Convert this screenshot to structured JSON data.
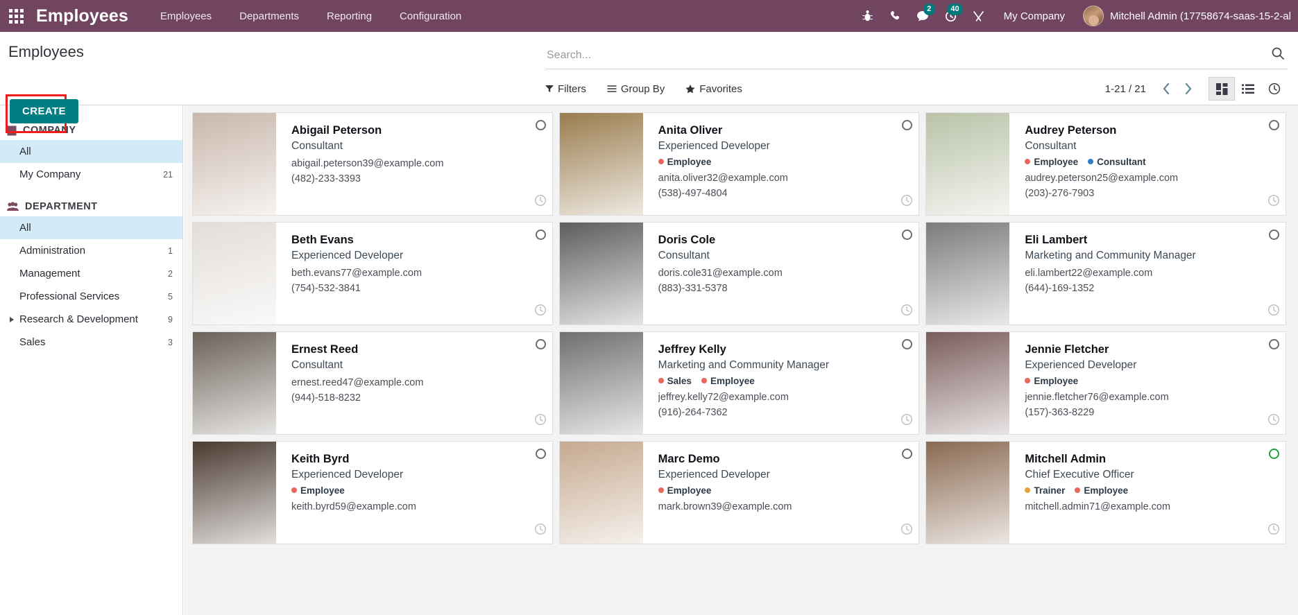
{
  "navbar": {
    "apps_icon": "apps-grid-icon",
    "brand": "Employees",
    "menu": [
      {
        "label": "Employees"
      },
      {
        "label": "Departments"
      },
      {
        "label": "Reporting"
      },
      {
        "label": "Configuration"
      }
    ],
    "icons": [
      {
        "name": "bug-icon",
        "badge": ""
      },
      {
        "name": "phone-icon",
        "badge": ""
      },
      {
        "name": "messages-icon",
        "badge": "2"
      },
      {
        "name": "activities-clock-icon",
        "badge": "40"
      },
      {
        "name": "tools-icon",
        "badge": ""
      }
    ],
    "company": "My Company",
    "user": "Mitchell Admin (17758674-saas-15-2-al",
    "badge_color": "#00787a",
    "background": "#71445f"
  },
  "control_panel": {
    "title": "Employees",
    "create_label": "CREATE",
    "create_color": "#017e84",
    "highlight_color": "#f01c1c",
    "search_placeholder": "Search...",
    "search_icon": "search-icon",
    "filters_label": "Filters",
    "group_by_label": "Group By",
    "favorites_label": "Favorites",
    "pager": "1-21 / 21",
    "prev_icon": "chevron-left-icon",
    "next_icon": "chevron-right-icon",
    "views": [
      {
        "name": "kanban-view",
        "icon": "kanban-icon",
        "active": true
      },
      {
        "name": "list-view",
        "icon": "list-icon",
        "active": false
      },
      {
        "name": "activity-view",
        "icon": "clock-icon",
        "active": false
      }
    ]
  },
  "sidebar": {
    "sections": [
      {
        "title": "COMPANY",
        "icon": "building-icon",
        "items": [
          {
            "label": "All",
            "count": "",
            "active": true,
            "expandable": false
          },
          {
            "label": "My Company",
            "count": "21",
            "active": false,
            "expandable": false
          }
        ]
      },
      {
        "title": "DEPARTMENT",
        "icon": "users-icon",
        "items": [
          {
            "label": "All",
            "count": "",
            "active": true,
            "expandable": false
          },
          {
            "label": "Administration",
            "count": "1",
            "active": false,
            "expandable": false
          },
          {
            "label": "Management",
            "count": "2",
            "active": false,
            "expandable": false
          },
          {
            "label": "Professional Services",
            "count": "5",
            "active": false,
            "expandable": false
          },
          {
            "label": "Research & Development",
            "count": "9",
            "active": false,
            "expandable": true
          },
          {
            "label": "Sales",
            "count": "3",
            "active": false,
            "expandable": false
          }
        ]
      }
    ]
  },
  "employees": [
    {
      "name": "Abigail Peterson",
      "job": "Consultant",
      "tags": [],
      "email": "abigail.peterson39@example.com",
      "phone": "(482)-233-3393",
      "status": "grey",
      "photo": "#c9b7ab"
    },
    {
      "name": "Anita Oliver",
      "job": "Experienced Developer",
      "tags": [
        {
          "label": "Employee",
          "color": "#e8675f"
        }
      ],
      "email": "anita.oliver32@example.com",
      "phone": "(538)-497-4804",
      "status": "grey",
      "photo": "#9a7c4e"
    },
    {
      "name": "Audrey Peterson",
      "job": "Consultant",
      "tags": [
        {
          "label": "Employee",
          "color": "#e8675f"
        },
        {
          "label": "Consultant",
          "color": "#2f7fc4"
        }
      ],
      "email": "audrey.peterson25@example.com",
      "phone": "(203)-276-7903",
      "status": "grey",
      "photo": "#b9c2a8"
    },
    {
      "name": "Beth Evans",
      "job": "Experienced Developer",
      "tags": [],
      "email": "beth.evans77@example.com",
      "phone": "(754)-532-3841",
      "status": "grey",
      "photo": "#e2ddd8"
    },
    {
      "name": "Doris Cole",
      "job": "Consultant",
      "tags": [],
      "email": "doris.cole31@example.com",
      "phone": "(883)-331-5378",
      "status": "grey",
      "photo": "#5d5d5d"
    },
    {
      "name": "Eli Lambert",
      "job": "Marketing and Community Manager",
      "tags": [],
      "email": "eli.lambert22@example.com",
      "phone": "(644)-169-1352",
      "status": "grey",
      "photo": "#7b7b7b"
    },
    {
      "name": "Ernest Reed",
      "job": "Consultant",
      "tags": [],
      "email": "ernest.reed47@example.com",
      "phone": "(944)-518-8232",
      "status": "grey",
      "photo": "#6b6258"
    },
    {
      "name": "Jeffrey Kelly",
      "job": "Marketing and Community Manager",
      "tags": [
        {
          "label": "Sales",
          "color": "#e8675f"
        },
        {
          "label": "Employee",
          "color": "#e8675f"
        }
      ],
      "email": "jeffrey.kelly72@example.com",
      "phone": "(916)-264-7362",
      "status": "grey",
      "photo": "#6f6f6f"
    },
    {
      "name": "Jennie Fletcher",
      "job": "Experienced Developer",
      "tags": [
        {
          "label": "Employee",
          "color": "#e8675f"
        }
      ],
      "email": "jennie.fletcher76@example.com",
      "phone": "(157)-363-8229",
      "status": "grey",
      "photo": "#7a5c5c"
    },
    {
      "name": "Keith Byrd",
      "job": "Experienced Developer",
      "tags": [
        {
          "label": "Employee",
          "color": "#e8675f"
        }
      ],
      "email": "keith.byrd59@example.com",
      "phone": "",
      "status": "grey",
      "photo": "#4a3a30"
    },
    {
      "name": "Marc Demo",
      "job": "Experienced Developer",
      "tags": [
        {
          "label": "Employee",
          "color": "#e8675f"
        }
      ],
      "email": "mark.brown39@example.com",
      "phone": "",
      "status": "grey",
      "photo": "#c6a98f"
    },
    {
      "name": "Mitchell Admin",
      "job": "Chief Executive Officer",
      "tags": [
        {
          "label": "Trainer",
          "color": "#e8a23d"
        },
        {
          "label": "Employee",
          "color": "#e8675f"
        }
      ],
      "email": "mitchell.admin71@example.com",
      "phone": "",
      "status": "green",
      "photo": "#8a6a52"
    }
  ]
}
